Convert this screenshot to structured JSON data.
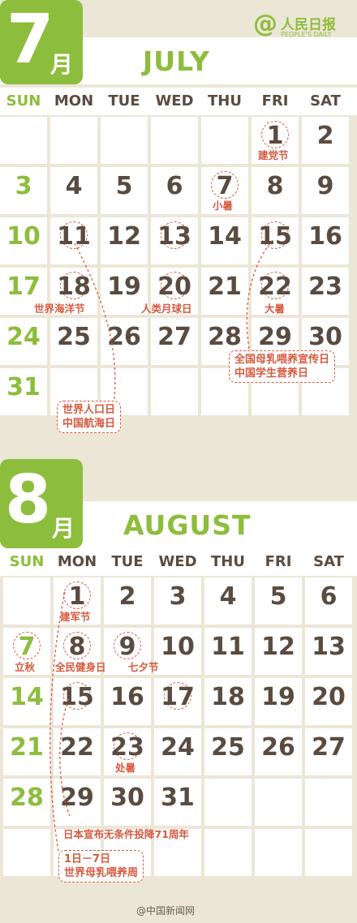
{
  "logo": {
    "mark": "@",
    "cn": "人民日报",
    "en": "PEOPLE'S DAILY"
  },
  "weekdays": [
    "SUN",
    "MON",
    "TUE",
    "WED",
    "THU",
    "FRI",
    "SAT"
  ],
  "july": {
    "badge_num": "7",
    "badge_yue": "月",
    "name": "JULY",
    "rows": [
      [
        "",
        "",
        "",
        "",
        "",
        "1",
        "2"
      ],
      [
        "3",
        "4",
        "5",
        "6",
        "7",
        "8",
        "9"
      ],
      [
        "10",
        "11",
        "12",
        "13",
        "14",
        "15",
        "16"
      ],
      [
        "17",
        "18",
        "19",
        "20",
        "21",
        "22",
        "23"
      ],
      [
        "24",
        "25",
        "26",
        "27",
        "28",
        "29",
        "30"
      ],
      [
        "31",
        "",
        "",
        "",
        "",
        "",
        ""
      ]
    ],
    "notes": {
      "d1": "建党节",
      "d7": "小暑",
      "d18": "世界海洋节",
      "d20": "人类月球日",
      "d22": "大暑",
      "d15_line1": "全国母乳喂养宣传日",
      "d15_line2": "中国学生营养日",
      "d11_line1": "世界人口日",
      "d11_line2": "中国航海日"
    }
  },
  "august": {
    "badge_num": "8",
    "badge_yue": "月",
    "name": "AUGUST",
    "rows": [
      [
        "",
        "1",
        "2",
        "3",
        "4",
        "5",
        "6"
      ],
      [
        "7",
        "8",
        "9",
        "10",
        "11",
        "12",
        "13"
      ],
      [
        "14",
        "15",
        "16",
        "17",
        "18",
        "19",
        "20"
      ],
      [
        "21",
        "22",
        "23",
        "24",
        "25",
        "26",
        "27"
      ],
      [
        "28",
        "29",
        "30",
        "31",
        "",
        "",
        ""
      ],
      [
        "",
        "",
        "",
        "",
        "",
        "",
        ""
      ]
    ],
    "notes": {
      "d1": "建军节",
      "d7": "立秋",
      "d8": "全民健身日",
      "d9": "七夕节",
      "d23": "处暑",
      "d15": "日本宣布无条件投降71周年",
      "d1_7_line1": "1日－7日",
      "d1_7_line2": "世界母乳喂养周"
    }
  },
  "watermark": "@中国新闻网"
}
